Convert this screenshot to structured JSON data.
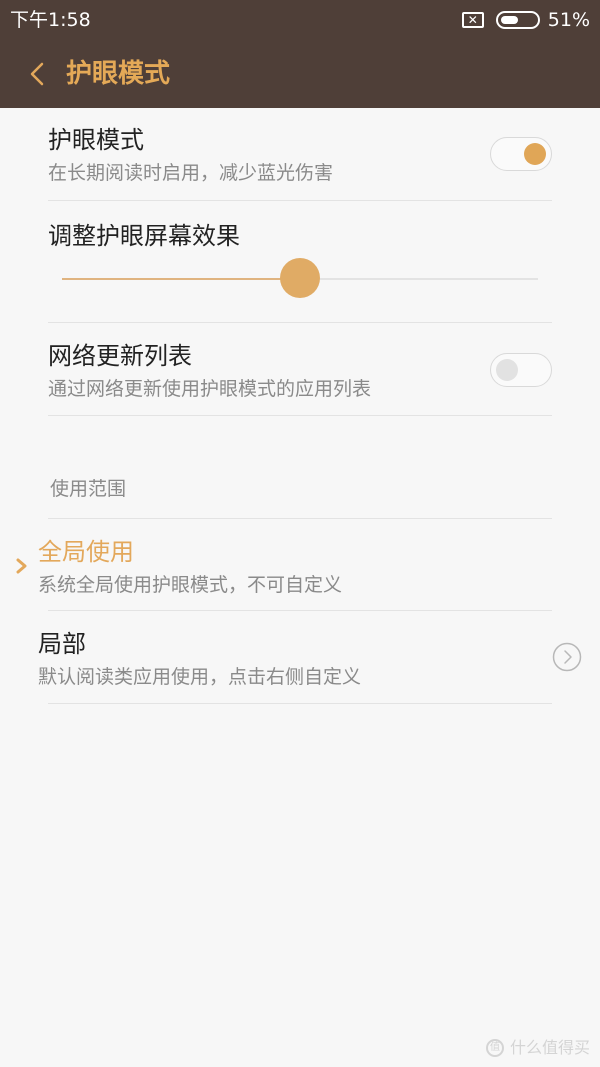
{
  "status_bar": {
    "time": "下午1:58",
    "battery_text": "51%",
    "battery_level": 0.51,
    "sim_icon": "no-sim-icon",
    "battery_icon": "battery-icon"
  },
  "toolbar": {
    "back_icon": "chevron-left-icon",
    "title": "护眼模式"
  },
  "settings": {
    "eye_mode": {
      "title": "护眼模式",
      "subtitle": "在长期阅读时启用，减少蓝光伤害",
      "enabled": true
    },
    "screen_effect": {
      "title": "调整护眼屏幕效果",
      "level": 0.5
    },
    "network_update": {
      "title": "网络更新列表",
      "subtitle": "通过网络更新使用护眼模式的应用列表",
      "enabled": false
    }
  },
  "scope": {
    "header": "使用范围",
    "options": [
      {
        "title": "全局使用",
        "subtitle": "系统全局使用护眼模式，不可自定义",
        "selected": true
      },
      {
        "title": "局部",
        "subtitle": "默认阅读类应用使用，点击右侧自定义",
        "selected": false
      }
    ]
  },
  "watermark": {
    "text": "什么值得买",
    "logo_text": "值"
  },
  "colors": {
    "bar_background": "#4f3f38",
    "accent": "#e3a85b",
    "page_background": "#f7f7f7"
  }
}
